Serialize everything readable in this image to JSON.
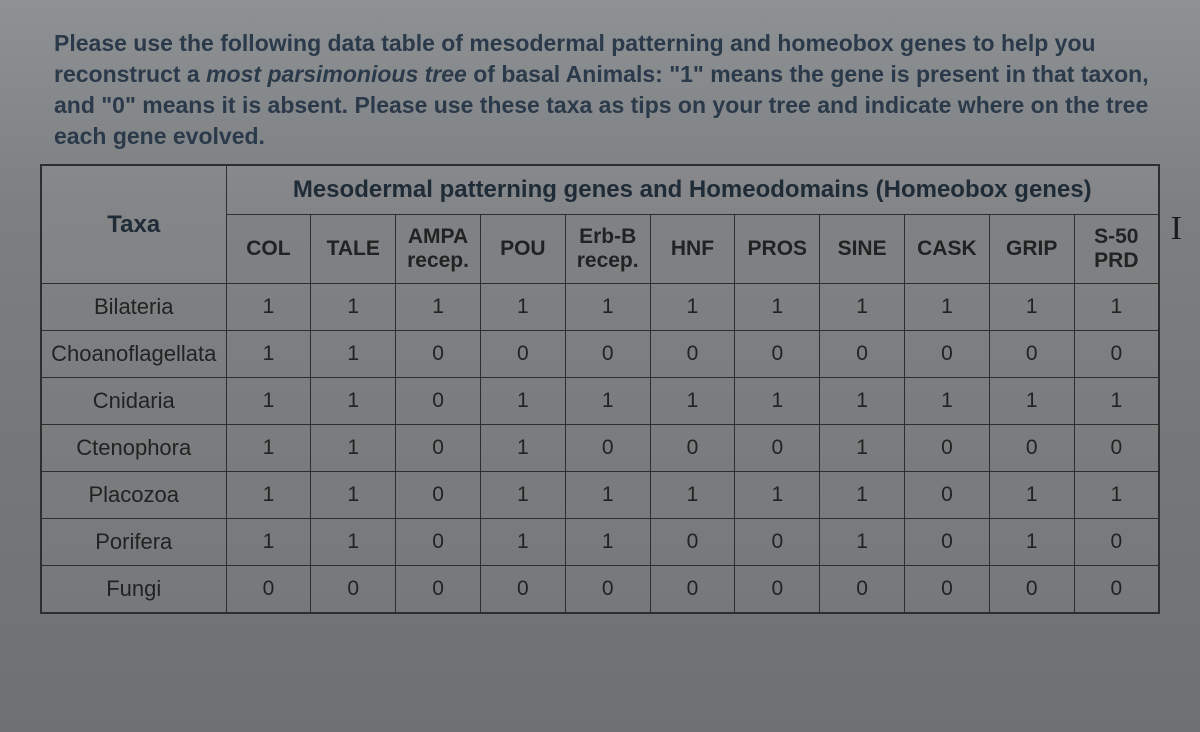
{
  "instructions_html": "Please use the following data table of mesodermal patterning and homeobox genes to help you reconstruct a <em>most parsimonious tree</em> of basal Animals: \"1\" means the gene is present in that taxon, and \"0\" means it is absent. Please use these taxa as tips on your tree and indicate where on the tree each gene evolved.",
  "banner": "Mesodermal patterning genes and Homeodomains (Homeobox genes)",
  "row_label_header": "Taxa",
  "columns": [
    "COL",
    "TALE",
    "AMPA recep.",
    "POU",
    "Erb-B recep.",
    "HNF",
    "PROS",
    "SINE",
    "CASK",
    "GRIP",
    "S-50 PRD"
  ],
  "rows": [
    {
      "taxon": "Bilateria",
      "v": [
        1,
        1,
        1,
        1,
        1,
        1,
        1,
        1,
        1,
        1,
        1
      ]
    },
    {
      "taxon": "Choanoflagellata",
      "v": [
        1,
        1,
        0,
        0,
        0,
        0,
        0,
        0,
        0,
        0,
        0
      ]
    },
    {
      "taxon": "Cnidaria",
      "v": [
        1,
        1,
        0,
        1,
        1,
        1,
        1,
        1,
        1,
        1,
        1
      ]
    },
    {
      "taxon": "Ctenophora",
      "v": [
        1,
        1,
        0,
        1,
        0,
        0,
        0,
        1,
        0,
        0,
        0
      ]
    },
    {
      "taxon": "Placozoa",
      "v": [
        1,
        1,
        0,
        1,
        1,
        1,
        1,
        1,
        0,
        1,
        1
      ]
    },
    {
      "taxon": "Porifera",
      "v": [
        1,
        1,
        0,
        1,
        1,
        0,
        0,
        1,
        0,
        1,
        0
      ]
    },
    {
      "taxon": "Fungi",
      "v": [
        0,
        0,
        0,
        0,
        0,
        0,
        0,
        0,
        0,
        0,
        0
      ]
    }
  ],
  "cursor_glyph": "I",
  "chart_data": {
    "type": "table",
    "title": "Mesodermal patterning genes and Homeodomains (Homeobox genes)",
    "row_headers": [
      "Bilateria",
      "Choanoflagellata",
      "Cnidaria",
      "Ctenophora",
      "Placozoa",
      "Porifera",
      "Fungi"
    ],
    "column_headers": [
      "COL",
      "TALE",
      "AMPA recep.",
      "POU",
      "Erb-B recep.",
      "HNF",
      "PROS",
      "SINE",
      "CASK",
      "GRIP",
      "S-50 PRD"
    ],
    "values": [
      [
        1,
        1,
        1,
        1,
        1,
        1,
        1,
        1,
        1,
        1,
        1
      ],
      [
        1,
        1,
        0,
        0,
        0,
        0,
        0,
        0,
        0,
        0,
        0
      ],
      [
        1,
        1,
        0,
        1,
        1,
        1,
        1,
        1,
        1,
        1,
        1
      ],
      [
        1,
        1,
        0,
        1,
        0,
        0,
        0,
        1,
        0,
        0,
        0
      ],
      [
        1,
        1,
        0,
        1,
        1,
        1,
        1,
        1,
        0,
        1,
        1
      ],
      [
        1,
        1,
        0,
        1,
        1,
        0,
        0,
        1,
        0,
        1,
        0
      ],
      [
        0,
        0,
        0,
        0,
        0,
        0,
        0,
        0,
        0,
        0,
        0
      ]
    ]
  }
}
